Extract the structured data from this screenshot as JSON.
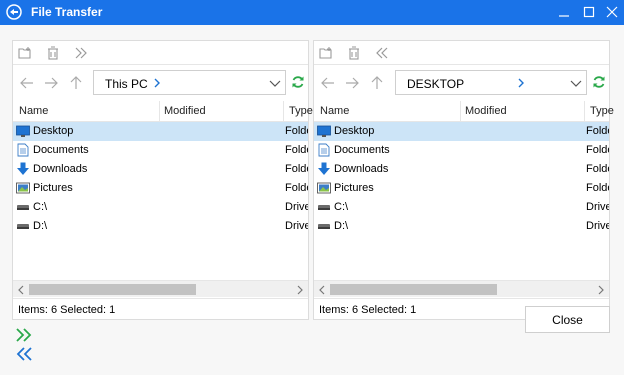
{
  "window": {
    "title": "File Transfer"
  },
  "colors": {
    "titlebar": "#1a73e8",
    "selection": "#cce4f7",
    "folder_blue": "#1e73d2",
    "refresh_green": "#2aa84a",
    "copy_right_green": "#2aa84a",
    "copy_left_blue": "#1e73d2"
  },
  "left_pane": {
    "path": "This PC",
    "columns": {
      "name": "Name",
      "modified": "Modified",
      "type": "Type"
    },
    "rows": [
      {
        "icon": "desktop-icon",
        "name": "Desktop",
        "type": "Folder",
        "selected": true
      },
      {
        "icon": "document-icon",
        "name": "Documents",
        "type": "Folder",
        "selected": false
      },
      {
        "icon": "download-icon",
        "name": "Downloads",
        "type": "Folder",
        "selected": false
      },
      {
        "icon": "pictures-icon",
        "name": "Pictures",
        "type": "Folder",
        "selected": false
      },
      {
        "icon": "drive-icon",
        "name": "C:\\",
        "type": "Drive",
        "selected": false
      },
      {
        "icon": "drive-icon",
        "name": "D:\\",
        "type": "Drive",
        "selected": false
      }
    ],
    "status": "Items: 6  Selected: 1"
  },
  "right_pane": {
    "path": "DESKTOP",
    "columns": {
      "name": "Name",
      "modified": "Modified",
      "type": "Type"
    },
    "rows": [
      {
        "icon": "desktop-icon",
        "name": "Desktop",
        "type": "Folder",
        "selected": true
      },
      {
        "icon": "document-icon",
        "name": "Documents",
        "type": "Folder",
        "selected": false
      },
      {
        "icon": "download-icon",
        "name": "Downloads",
        "type": "Folder",
        "selected": false
      },
      {
        "icon": "pictures-icon",
        "name": "Pictures",
        "type": "Folder",
        "selected": false
      },
      {
        "icon": "drive-icon",
        "name": "C:\\",
        "type": "Drive",
        "selected": false
      },
      {
        "icon": "drive-icon",
        "name": "D:\\",
        "type": "Drive",
        "selected": false
      }
    ],
    "status": "Items: 6  Selected: 1"
  },
  "footer": {
    "close_label": "Close"
  }
}
